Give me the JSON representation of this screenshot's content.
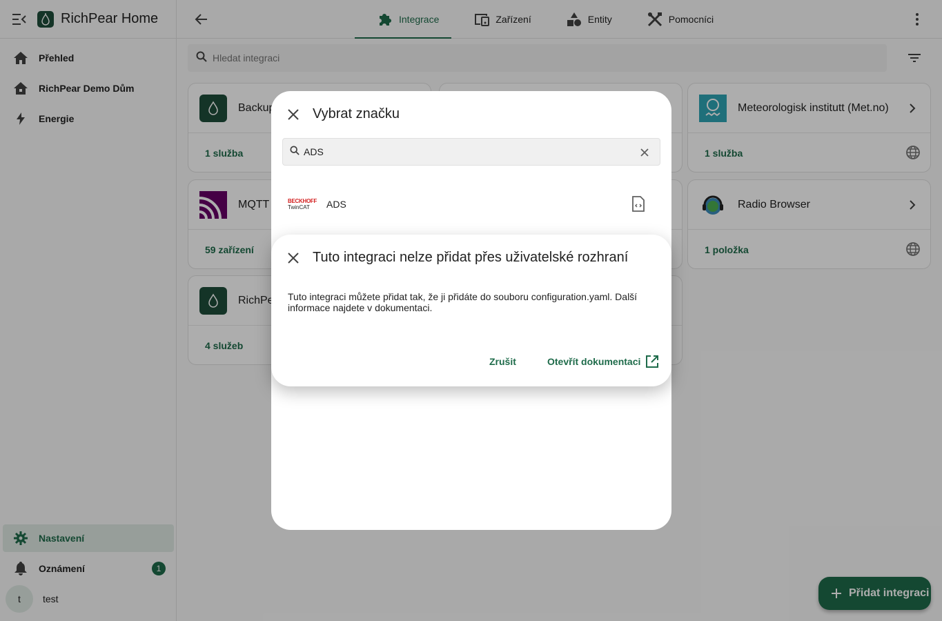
{
  "app": {
    "title": "RichPear Home"
  },
  "sidebar": {
    "items": [
      {
        "label": "Přehled",
        "icon": "home-icon"
      },
      {
        "label": "RichPear Demo Dům",
        "icon": "home-variant-icon"
      },
      {
        "label": "Energie",
        "icon": "lightning-icon"
      }
    ],
    "bottom": [
      {
        "label": "Nastavení",
        "icon": "gear-icon",
        "active": true
      },
      {
        "label": "Oznámení",
        "icon": "bell-icon",
        "badge": "1"
      },
      {
        "label": "test",
        "avatar": "t"
      }
    ]
  },
  "tabs": [
    {
      "label": "Integrace",
      "icon": "puzzle-icon",
      "active": true
    },
    {
      "label": "Zařízení",
      "icon": "devices-icon"
    },
    {
      "label": "Entity",
      "icon": "shapes-icon"
    },
    {
      "label": "Pomocníci",
      "icon": "tools-icon"
    }
  ],
  "search": {
    "placeholder": "Hledat integraci"
  },
  "cards": [
    {
      "name": "Backup",
      "footer": "1 služba"
    },
    {
      "name": "Meteorologisk institutt (Met.no)",
      "footer": "1 služba"
    },
    {
      "name": "MQTT",
      "footer": "59 zařízení"
    },
    {
      "name": "Radio Browser",
      "footer": "1 položka"
    },
    {
      "name": "RichPear",
      "footer": "4 služeb"
    }
  ],
  "fab": {
    "label": "Přidat integraci"
  },
  "brand_dialog": {
    "title": "Vybrat značku",
    "search_value": "ADS",
    "item": {
      "name": "ADS",
      "logo_top": "BECKHOFF",
      "logo_bottom": "TwinCAT"
    }
  },
  "alert": {
    "title": "Tuto integraci nelze přidat přes uživatelské rozhraní",
    "body": "Tuto integraci můžete přidat tak, že ji přidáte do souboru configuration.yaml. Další informace najdete v dokumentaci.",
    "cancel": "Zrušit",
    "open_docs": "Otevřít dokumentaci"
  },
  "colors": {
    "primary": "#1e6b4a",
    "active_bg": "#dfe9e4"
  }
}
